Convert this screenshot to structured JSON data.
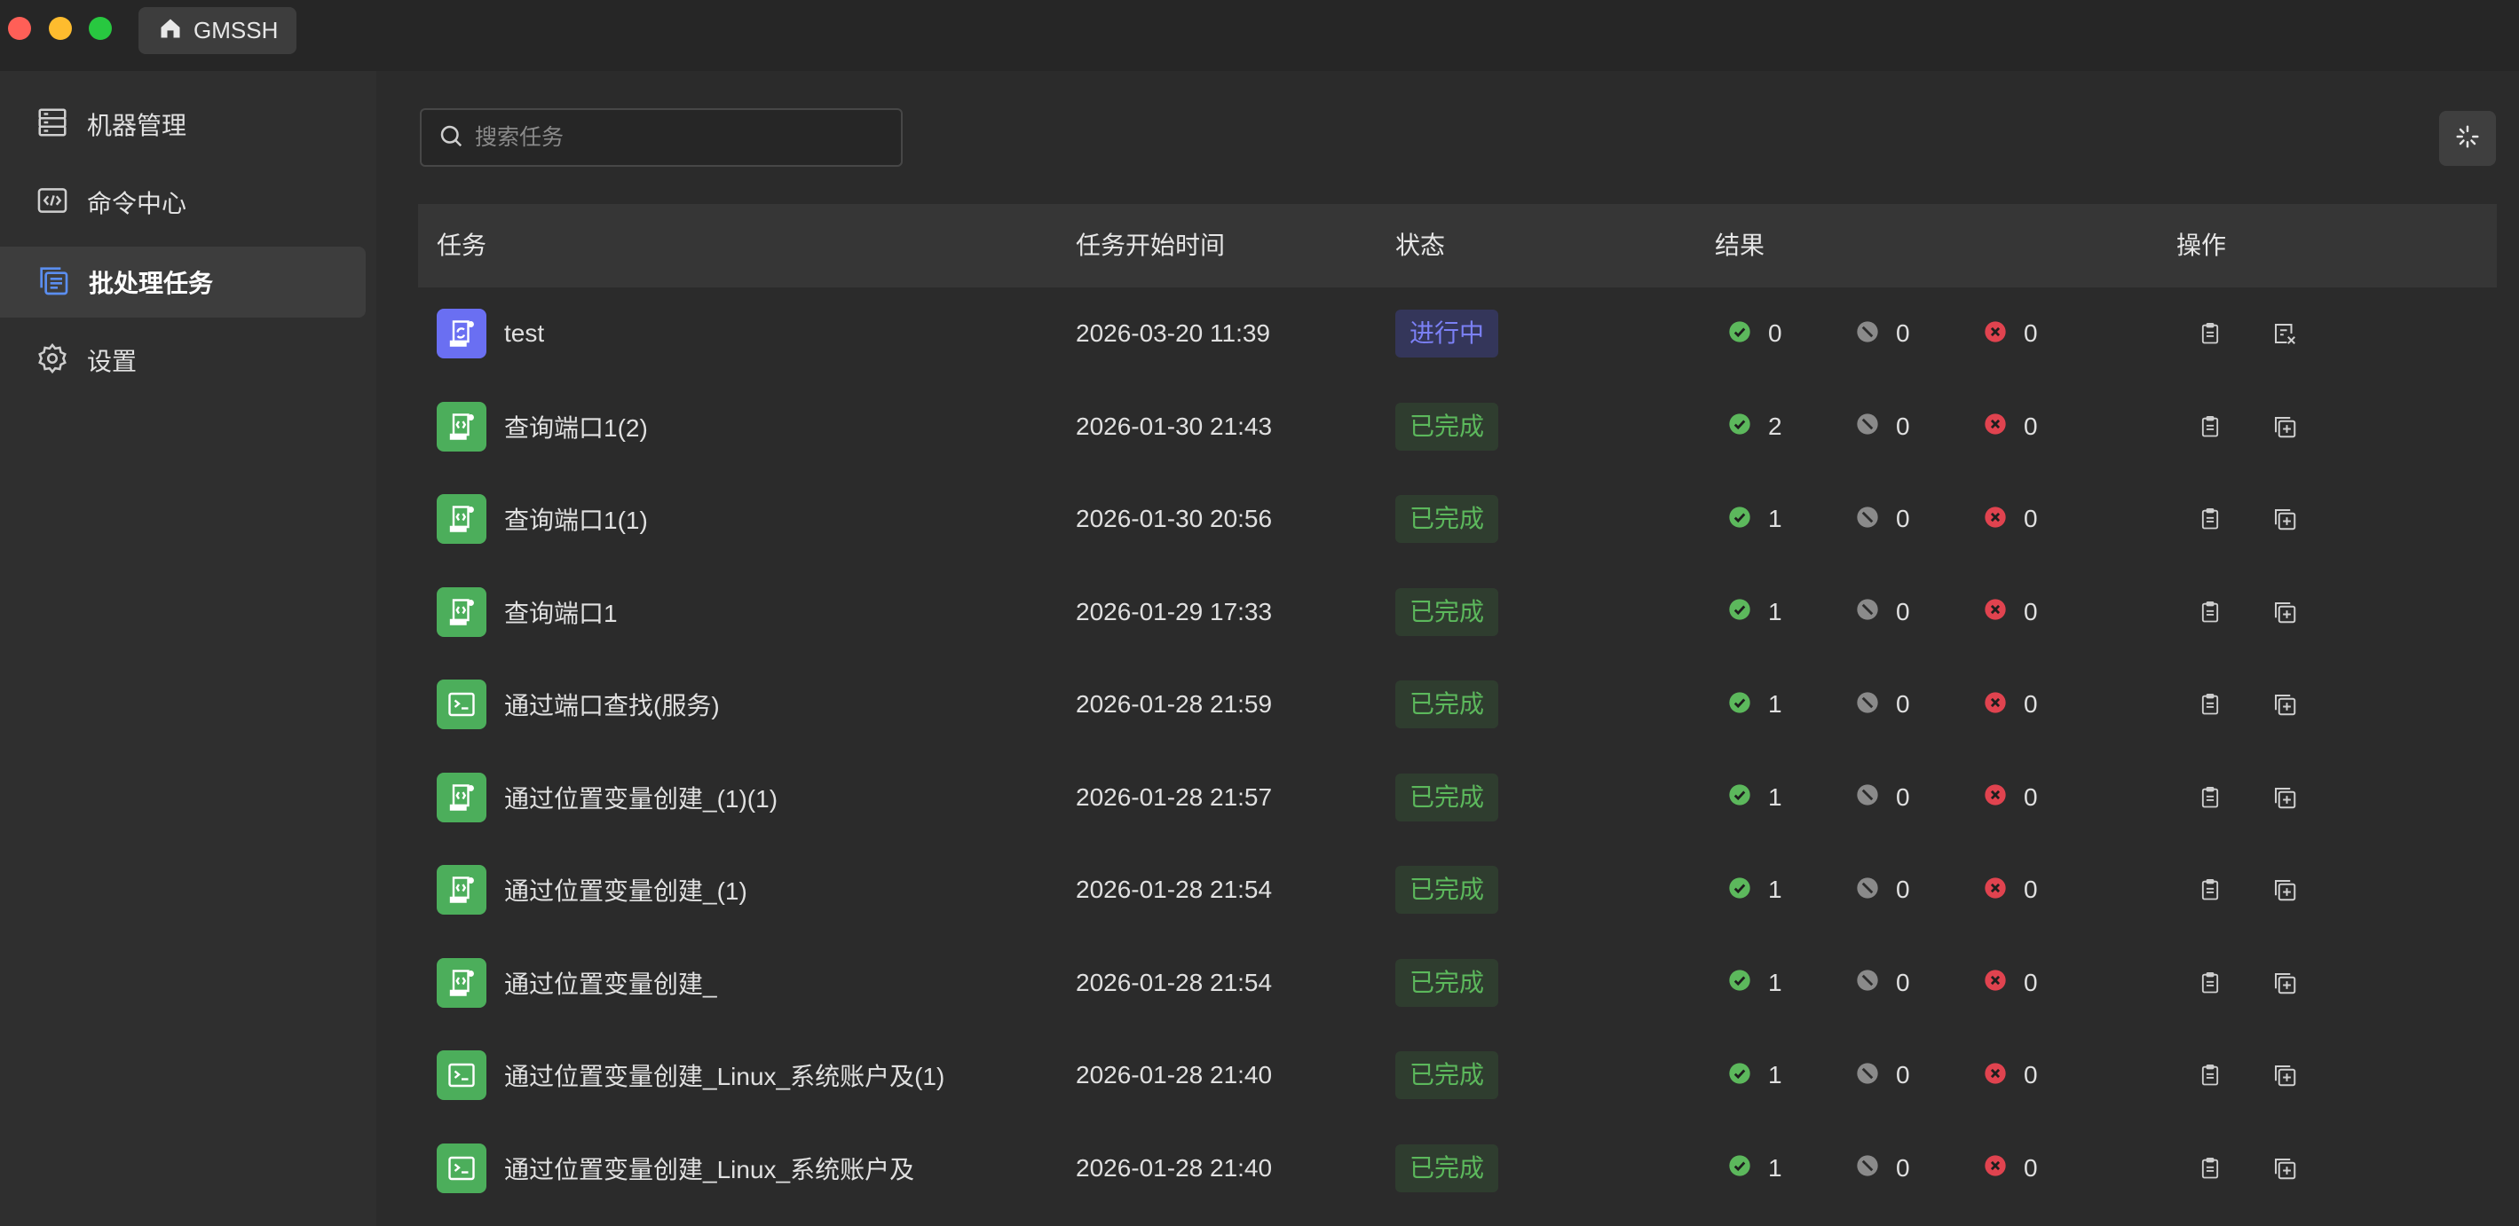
{
  "app": {
    "tab_title": "GMSSH"
  },
  "sidebar": {
    "items": [
      {
        "label": "机器管理",
        "icon": "server-icon",
        "active": false
      },
      {
        "label": "命令中心",
        "icon": "code-icon",
        "active": false
      },
      {
        "label": "批处理任务",
        "icon": "batch-icon",
        "active": true
      },
      {
        "label": "设置",
        "icon": "gear-icon",
        "active": false
      }
    ]
  },
  "search": {
    "placeholder": "搜索任务",
    "value": ""
  },
  "table": {
    "headers": {
      "task": "任务",
      "start_time": "任务开始时间",
      "status": "状态",
      "result": "结果",
      "actions": "操作"
    },
    "rows": [
      {
        "name": "test",
        "time": "2026-03-20 11:39",
        "status": "进行中",
        "status_kind": "running",
        "icon": "refresh-script-icon",
        "success": "0",
        "skipped": "0",
        "failed": "0",
        "second_action": "cancel-icon"
      },
      {
        "name": "查询端口1(2)",
        "time": "2026-01-30 21:43",
        "status": "已完成",
        "status_kind": "done",
        "icon": "script-icon",
        "success": "2",
        "skipped": "0",
        "failed": "0",
        "second_action": "copy-add-icon"
      },
      {
        "name": "查询端口1(1)",
        "time": "2026-01-30 20:56",
        "status": "已完成",
        "status_kind": "done",
        "icon": "script-icon",
        "success": "1",
        "skipped": "0",
        "failed": "0",
        "second_action": "copy-add-icon"
      },
      {
        "name": "查询端口1",
        "time": "2026-01-29 17:33",
        "status": "已完成",
        "status_kind": "done",
        "icon": "script-icon",
        "success": "1",
        "skipped": "0",
        "failed": "0",
        "second_action": "copy-add-icon"
      },
      {
        "name": "通过端口查找(服务)",
        "time": "2026-01-28 21:59",
        "status": "已完成",
        "status_kind": "done",
        "icon": "terminal-icon",
        "success": "1",
        "skipped": "0",
        "failed": "0",
        "second_action": "copy-add-icon"
      },
      {
        "name": "通过位置变量创建_(1)(1)",
        "time": "2026-01-28 21:57",
        "status": "已完成",
        "status_kind": "done",
        "icon": "script-icon",
        "success": "1",
        "skipped": "0",
        "failed": "0",
        "second_action": "copy-add-icon"
      },
      {
        "name": "通过位置变量创建_(1)",
        "time": "2026-01-28 21:54",
        "status": "已完成",
        "status_kind": "done",
        "icon": "script-icon",
        "success": "1",
        "skipped": "0",
        "failed": "0",
        "second_action": "copy-add-icon"
      },
      {
        "name": "通过位置变量创建_",
        "time": "2026-01-28 21:54",
        "status": "已完成",
        "status_kind": "done",
        "icon": "script-icon",
        "success": "1",
        "skipped": "0",
        "failed": "0",
        "second_action": "copy-add-icon"
      },
      {
        "name": "通过位置变量创建_Linux_系统账户及(1)",
        "time": "2026-01-28 21:40",
        "status": "已完成",
        "status_kind": "done",
        "icon": "terminal-icon",
        "success": "1",
        "skipped": "0",
        "failed": "0",
        "second_action": "copy-add-icon"
      },
      {
        "name": "通过位置变量创建_Linux_系统账户及",
        "time": "2026-01-28 21:40",
        "status": "已完成",
        "status_kind": "done",
        "icon": "terminal-icon",
        "success": "1",
        "skipped": "0",
        "failed": "0",
        "second_action": "copy-add-icon"
      }
    ]
  },
  "colors": {
    "success": "#5cb85c",
    "running": "#7b80f5",
    "failed": "#e0434f",
    "skipped": "#8a8a8a",
    "task_icon_green": "#4cae5b",
    "task_icon_blue": "#6a6ff2"
  }
}
